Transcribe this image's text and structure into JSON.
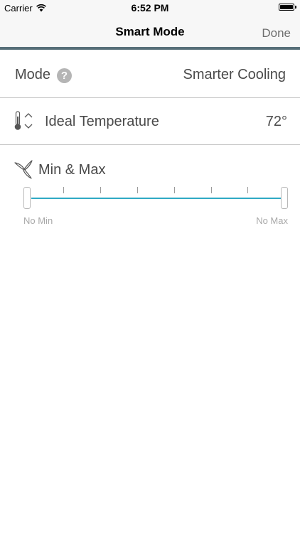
{
  "status_bar": {
    "carrier": "Carrier",
    "time": "6:52 PM",
    "icons": [
      "wifi-icon",
      "battery-icon"
    ]
  },
  "nav": {
    "title": "Smart Mode",
    "done_label": "Done",
    "accent_color": "#566e78"
  },
  "mode_row": {
    "label": "Mode",
    "help_glyph": "?",
    "value": "Smarter Cooling"
  },
  "temperature_row": {
    "icons": [
      "thermometer-icon",
      "stepper-icon"
    ],
    "label": "Ideal Temperature",
    "value": "72°"
  },
  "min_max": {
    "icon": "fan-icon",
    "title": "Min & Max",
    "min_label": "No Min",
    "max_label": "No Max",
    "track_color": "#2fa9c4",
    "tick_count": 7
  }
}
